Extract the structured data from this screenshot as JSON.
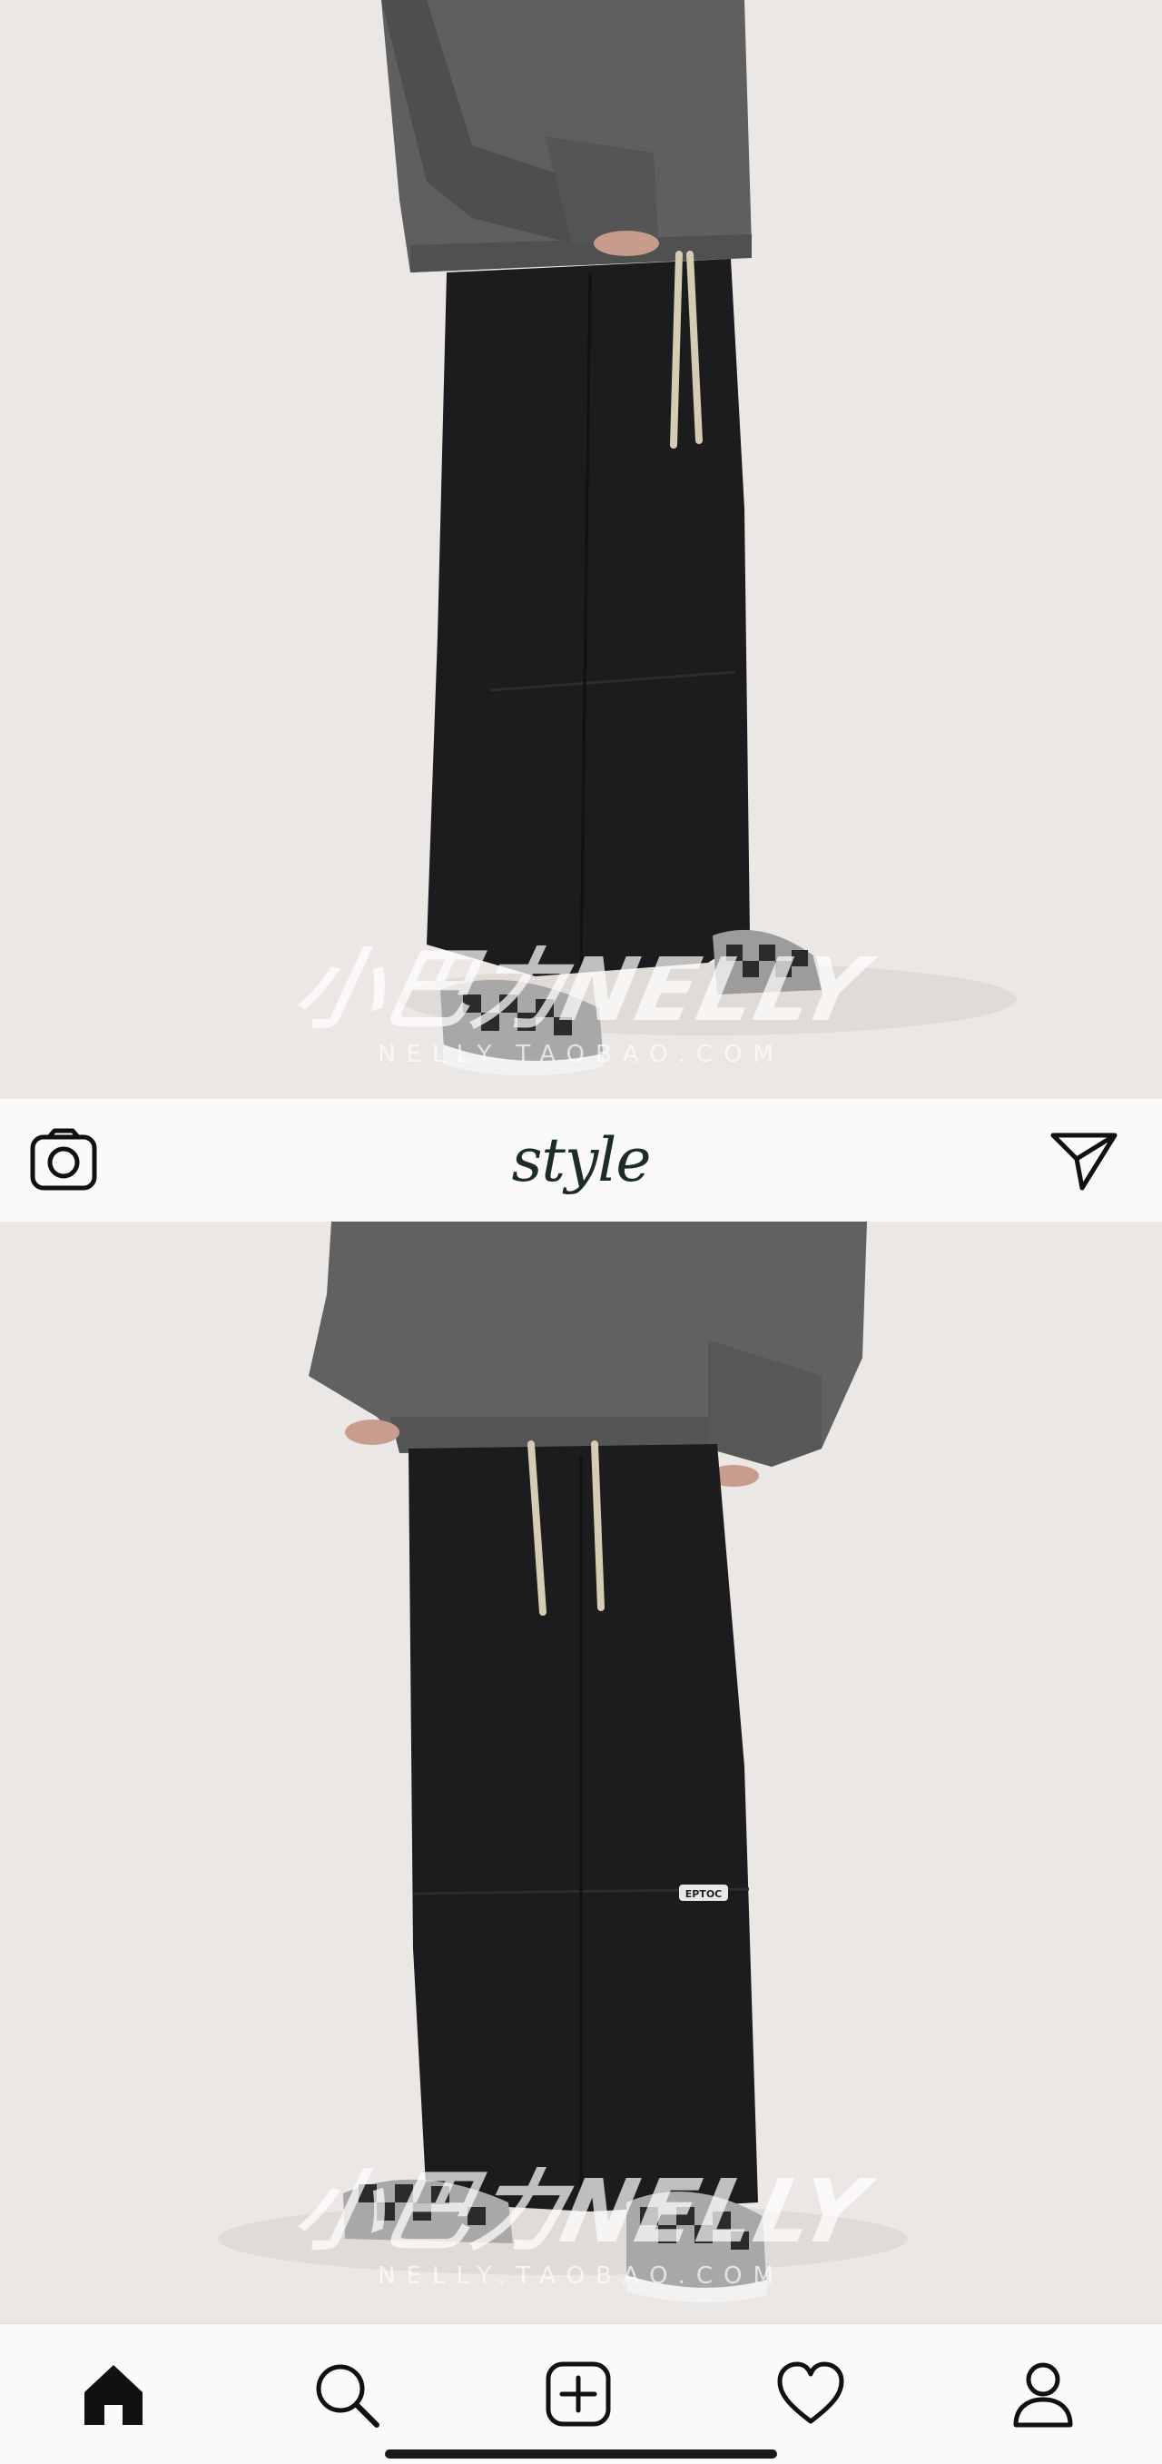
{
  "top_photo": {
    "watermark_logo": "小巴力NELLY",
    "watermark_url": "NELLY.TAOBAO.COM"
  },
  "header": {
    "title": "style",
    "left_icon": "camera-icon",
    "right_icon": "send-icon"
  },
  "bottom_photo": {
    "patch_text": "EPTOC",
    "watermark_logo": "小巴力NELLY",
    "watermark_url": "NELLY.TAOBAO.COM"
  },
  "tab_bar": {
    "items": [
      {
        "icon": "home-icon",
        "active": true
      },
      {
        "icon": "search-icon"
      },
      {
        "icon": "add-post-icon"
      },
      {
        "icon": "heart-icon"
      },
      {
        "icon": "profile-icon"
      }
    ]
  },
  "colors": {
    "background": "#ebe7e4",
    "bar_background": "#fafafa",
    "icon": "#111111",
    "title": "#1d2b2a",
    "sweatshirt": "#5c5c5c",
    "pants": "#1c1c1e",
    "drawstring": "#d6cbb3"
  }
}
